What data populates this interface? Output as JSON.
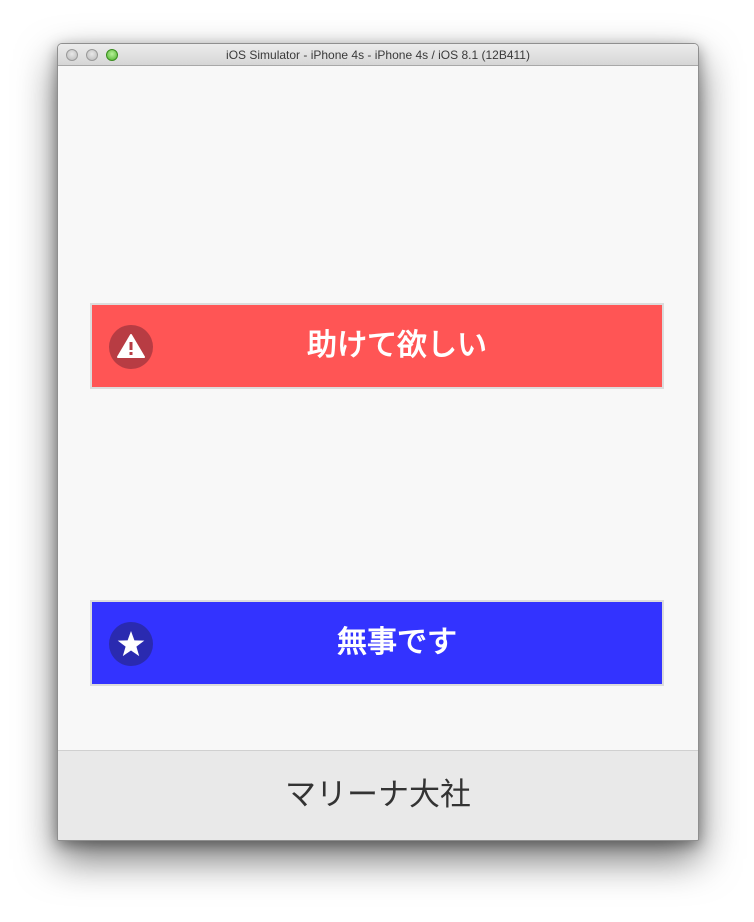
{
  "window": {
    "title": "iOS Simulator - iPhone 4s - iPhone 4s / iOS 8.1 (12B411)"
  },
  "buttons": {
    "help": {
      "label": "助けて欲しい",
      "icon": "warning-icon",
      "color": "#ff5555"
    },
    "safe": {
      "label": "無事です",
      "icon": "star-icon",
      "color": "#3333ff"
    }
  },
  "bottom_bar": {
    "label": "マリーナ大社"
  }
}
